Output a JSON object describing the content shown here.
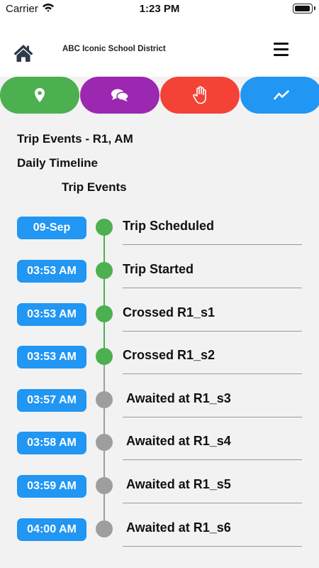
{
  "status_bar": {
    "carrier": "Carrier",
    "time": "1:23 PM"
  },
  "header": {
    "district": "ABC Iconic School District"
  },
  "tabs": [
    {
      "name": "location",
      "icon": "location-pin-icon",
      "color": "#4caf50"
    },
    {
      "name": "messages",
      "icon": "chat-bubbles-icon",
      "color": "#9c27b0"
    },
    {
      "name": "stop",
      "icon": "hand-icon",
      "color": "#f44336"
    },
    {
      "name": "timeline",
      "icon": "trend-icon",
      "color": "#2196f3"
    }
  ],
  "page": {
    "title": "Trip Events - R1, AM",
    "subtitle": "Daily Timeline",
    "section": "Trip Events"
  },
  "colors": {
    "completed": "#4caf50",
    "pending": "#9e9e9e",
    "time_badge": "#2196f3"
  },
  "events": [
    {
      "time": "09-Sep",
      "label": "Trip Scheduled",
      "status": "completed"
    },
    {
      "time": "03:53 AM",
      "label": "Trip Started",
      "status": "completed"
    },
    {
      "time": "03:53 AM",
      "label": "Crossed R1_s1",
      "status": "completed"
    },
    {
      "time": "03:53 AM",
      "label": "Crossed R1_s2",
      "status": "completed"
    },
    {
      "time": "03:57 AM",
      "label": "Awaited at R1_s3",
      "status": "pending"
    },
    {
      "time": "03:58 AM",
      "label": "Awaited at R1_s4",
      "status": "pending"
    },
    {
      "time": "03:59 AM",
      "label": "Awaited at R1_s5",
      "status": "pending"
    },
    {
      "time": "04:00 AM",
      "label": "Awaited at R1_s6",
      "status": "pending"
    }
  ]
}
